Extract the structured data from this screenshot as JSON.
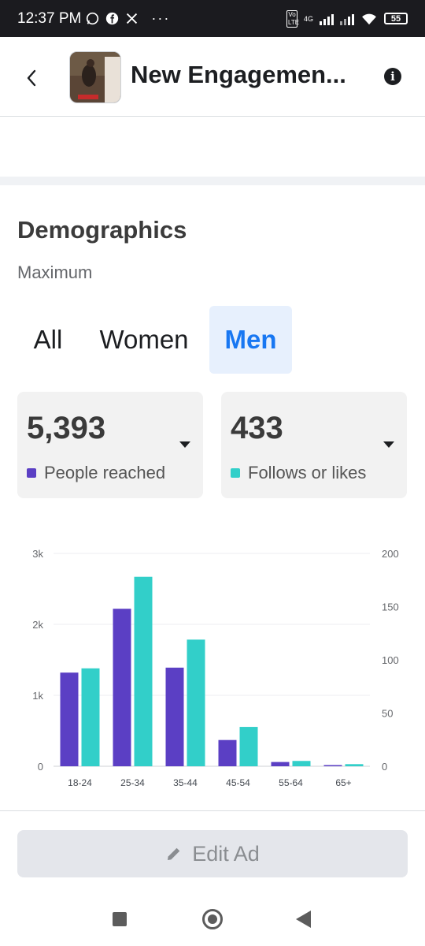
{
  "status_bar": {
    "time": "12:37 PM",
    "left_icons": [
      "whatsapp-icon",
      "facebook-icon",
      "x-icon",
      "more-dots-icon"
    ],
    "network_label": "4G",
    "volte_label": "Vo LTE",
    "battery": "55"
  },
  "header": {
    "title": "New Engagemen...",
    "thumbnail_label": "ad-creative-thumbnail"
  },
  "demographics": {
    "title": "Demographics",
    "subtitle": "Maximum",
    "tabs": [
      {
        "label": "All",
        "selected": false
      },
      {
        "label": "Women",
        "selected": false
      },
      {
        "label": "Men",
        "selected": true
      }
    ]
  },
  "metrics": [
    {
      "value": "5,393",
      "label": "People reached",
      "color": "#5b3fc4"
    },
    {
      "value": "433",
      "label": "Follows or likes",
      "color": "#32cfc9"
    }
  ],
  "chart_data": {
    "type": "bar",
    "categories": [
      "18-24",
      "25-34",
      "35-44",
      "45-54",
      "55-64",
      "65+"
    ],
    "series": [
      {
        "name": "People reached",
        "axis": "left",
        "color": "#5b3fc4",
        "values": [
          1320,
          2220,
          1390,
          370,
          60,
          15
        ]
      },
      {
        "name": "Follows or likes",
        "axis": "right",
        "color": "#32cfc9",
        "values": [
          92,
          178,
          119,
          37,
          5,
          2
        ]
      }
    ],
    "y_left": {
      "ticks": [
        "0",
        "1k",
        "2k",
        "3k"
      ],
      "ylim": [
        0,
        3000
      ]
    },
    "y_right": {
      "ticks": [
        "0",
        "50",
        "100",
        "150",
        "200"
      ],
      "ylim": [
        0,
        200
      ]
    },
    "grid": true
  },
  "footer": {
    "edit_label": "Edit Ad"
  },
  "colors": {
    "accent": "#1877f2",
    "reached": "#5b3fc4",
    "follows": "#32cfc9"
  }
}
